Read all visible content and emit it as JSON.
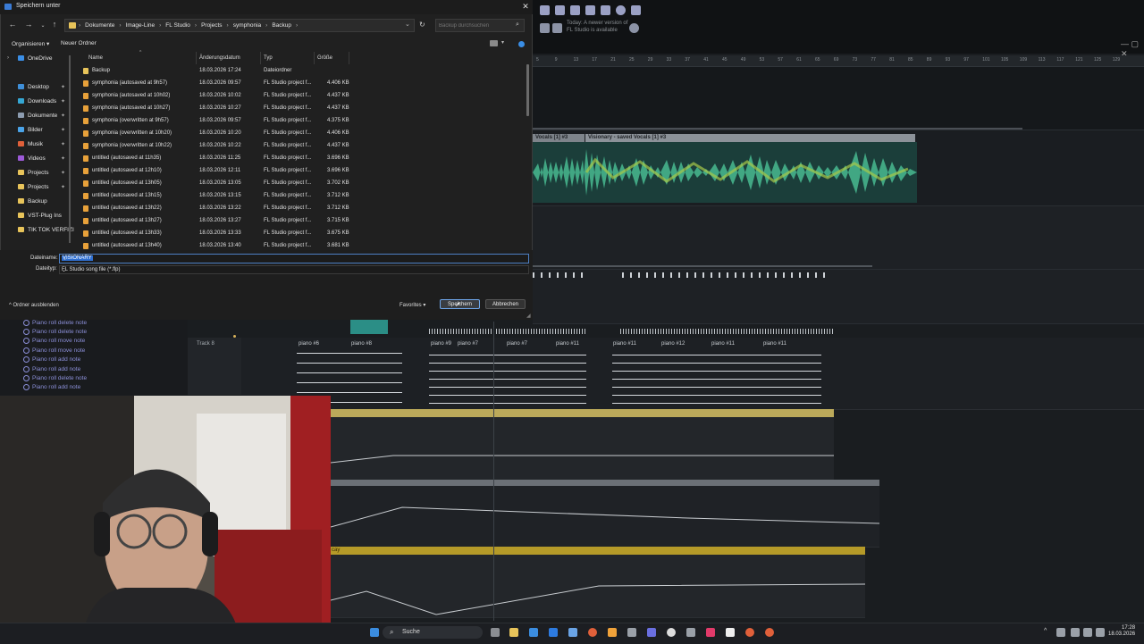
{
  "dialog": {
    "title": "Speichern unter",
    "breadcrumb": [
      "Dokumente",
      "Image-Line",
      "FL Studio",
      "Projects",
      "symphonia",
      "Backup"
    ],
    "search_placeholder": "Backup durchsuchen",
    "toolbar": {
      "organize": "Organisieren",
      "new_folder": "Neuer Ordner"
    },
    "tree": [
      {
        "label": "OneDrive",
        "icon": "cloud-icon"
      },
      {
        "label": "Desktop",
        "icon": "desktop-icon"
      },
      {
        "label": "Downloads",
        "icon": "download-icon"
      },
      {
        "label": "Dokumente",
        "icon": "document-icon"
      },
      {
        "label": "Bilder",
        "icon": "image-icon"
      },
      {
        "label": "Musik",
        "icon": "music-icon"
      },
      {
        "label": "Videos",
        "icon": "video-icon"
      },
      {
        "label": "Projects",
        "icon": "folder-icon"
      },
      {
        "label": "Projects",
        "icon": "folder-icon"
      },
      {
        "label": "Backup",
        "icon": "folder-icon"
      },
      {
        "label": "VST-Plug Ins",
        "icon": "folder-icon"
      },
      {
        "label": "TIK TOK VERFIZI",
        "icon": "folder-icon"
      }
    ],
    "columns": {
      "name": "Name",
      "date": "Änderungsdatum",
      "type": "Typ",
      "size": "Größe"
    },
    "files": [
      {
        "name": "Backup",
        "date": "18.03.2026 17:24",
        "type": "Dateiordner",
        "size": ""
      },
      {
        "name": "symphonia (autosaved at 9h57)",
        "date": "18.03.2026 09:57",
        "type": "FL Studio project f...",
        "size": "4.406 KB"
      },
      {
        "name": "symphonia (autosaved at 10h02)",
        "date": "18.03.2026 10:02",
        "type": "FL Studio project f...",
        "size": "4.437 KB"
      },
      {
        "name": "symphonia (autosaved at 10h27)",
        "date": "18.03.2026 10:27",
        "type": "FL Studio project f...",
        "size": "4.437 KB"
      },
      {
        "name": "symphonia (overwritten at 9h57)",
        "date": "18.03.2026 09:57",
        "type": "FL Studio project f...",
        "size": "4.375 KB"
      },
      {
        "name": "symphonia (overwritten at 10h20)",
        "date": "18.03.2026 10:20",
        "type": "FL Studio project f...",
        "size": "4.406 KB"
      },
      {
        "name": "symphonia (overwritten at 10h22)",
        "date": "18.03.2026 10:22",
        "type": "FL Studio project f...",
        "size": "4.437 KB"
      },
      {
        "name": "untitled (autosaved at 11h35)",
        "date": "18.03.2026 11:25",
        "type": "FL Studio project f...",
        "size": "3.696 KB"
      },
      {
        "name": "untitled (autosaved at 12h10)",
        "date": "18.03.2026 12:11",
        "type": "FL Studio project f...",
        "size": "3.696 KB"
      },
      {
        "name": "untitled (autosaved at 13h05)",
        "date": "18.03.2026 13:05",
        "type": "FL Studio project f...",
        "size": "3.702 KB"
      },
      {
        "name": "untitled (autosaved at 13h15)",
        "date": "18.03.2026 13:15",
        "type": "FL Studio project f...",
        "size": "3.712 KB"
      },
      {
        "name": "untitled (autosaved at 13h22)",
        "date": "18.03.2026 13:22",
        "type": "FL Studio project f...",
        "size": "3.712 KB"
      },
      {
        "name": "untitled (autosaved at 13h27)",
        "date": "18.03.2026 13:27",
        "type": "FL Studio project f...",
        "size": "3.715 KB"
      },
      {
        "name": "untitled (autosaved at 13h33)",
        "date": "18.03.2026 13:33",
        "type": "FL Studio project f...",
        "size": "3.675 KB"
      },
      {
        "name": "untitled (autosaved at 13h40)",
        "date": "18.03.2026 13:40",
        "type": "FL Studio project f...",
        "size": "3.681 KB"
      }
    ],
    "filename_label": "Dateiname:",
    "filename_value": "VISIONARY",
    "filetype_label": "Dateityp:",
    "filetype_value": "FL Studio song file (*.flp)",
    "hide_folders": "Ordner ausblenden",
    "favorites": "Favorites",
    "save": "Speichern",
    "cancel": "Abbrechen"
  },
  "fl": {
    "update_hint": "Today: A newer version of FL Studio is available",
    "ruler_numbers": [
      "5",
      "9",
      "13",
      "17",
      "21",
      "25",
      "29",
      "33",
      "37",
      "41",
      "45",
      "49",
      "53",
      "57",
      "61",
      "65",
      "69",
      "73",
      "77",
      "81",
      "85",
      "89",
      "93",
      "97",
      "101",
      "105",
      "109",
      "113",
      "117",
      "121",
      "125",
      "129"
    ],
    "audio_clip_left": "Vocals [1] #3",
    "audio_clip_right": "Visionary - saved Vocals [1] #3",
    "history": [
      "Piano roll delete note",
      "Piano roll delete note",
      "Piano roll move note",
      "Piano roll move note",
      "Piano roll add note",
      "Piano roll add note",
      "Piano roll delete note",
      "Piano roll add note",
      "Piano roll move note"
    ],
    "track_label": "Track 8",
    "patterns": [
      "piano #6",
      "piano #8",
      "piano #9",
      "piano #7",
      "piano #7",
      "piano #11",
      "piano #12",
      "piano #11",
      "piano #11"
    ],
    "auto_label": "cay"
  },
  "taskbar": {
    "search": "Suche",
    "time": "17:28",
    "date": "18.03.2026"
  }
}
